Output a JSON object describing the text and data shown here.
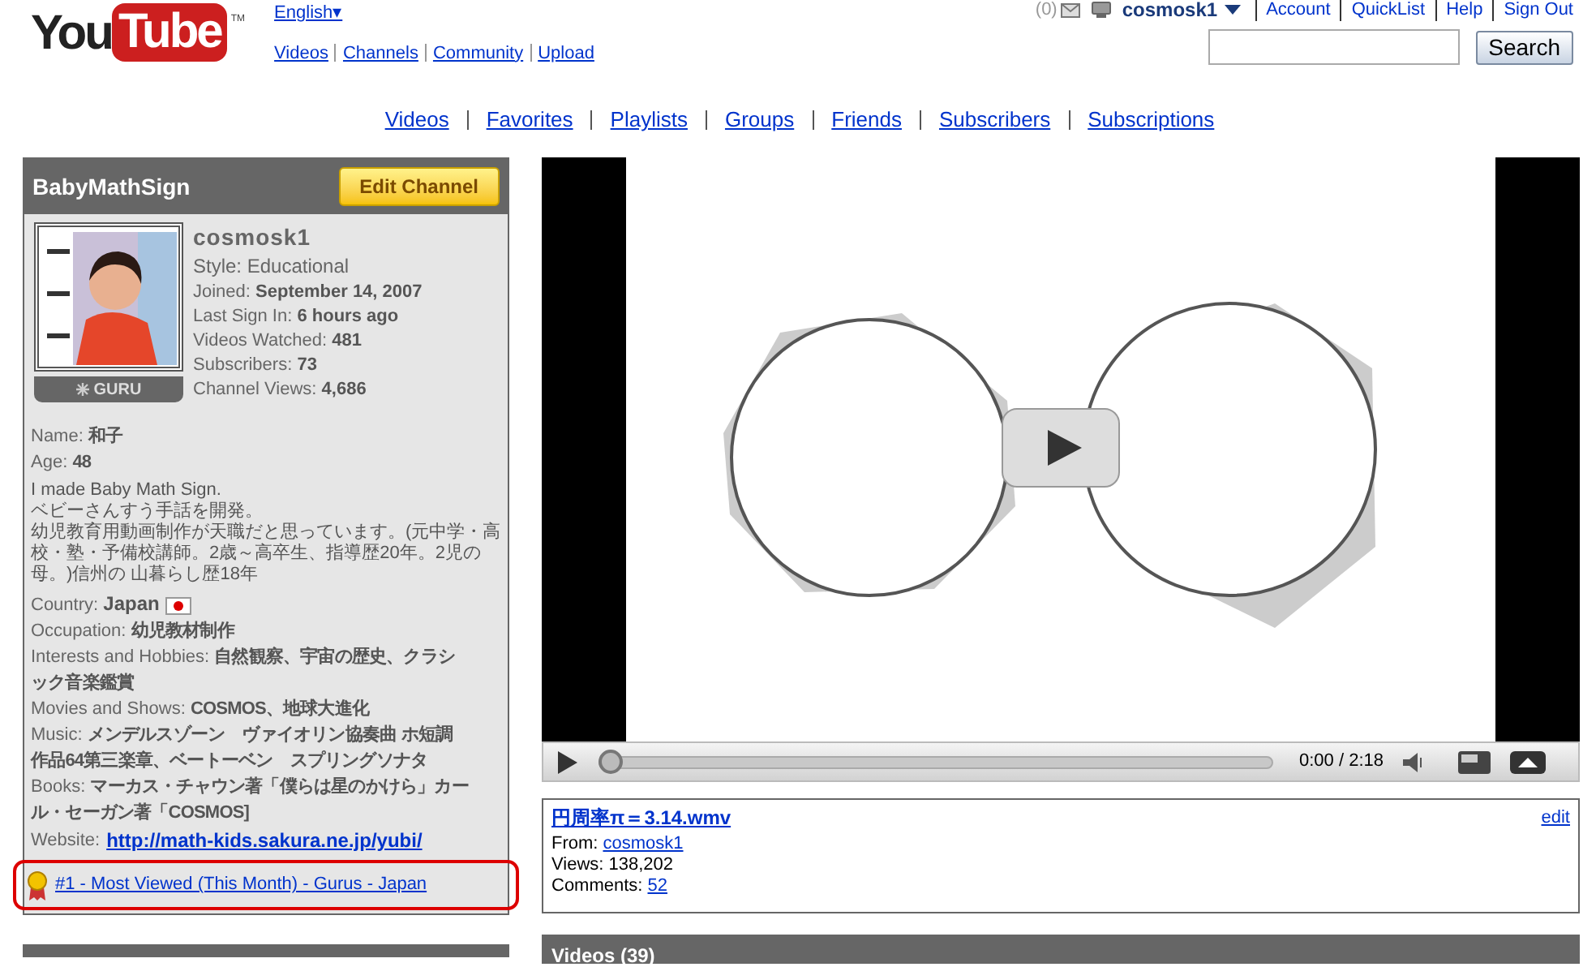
{
  "logo": {
    "left": "You",
    "right": "Tube",
    "mark": "TM"
  },
  "language": "English▾",
  "top_links": [
    "Videos",
    "Channels",
    "Community",
    "Upload"
  ],
  "user_bar": {
    "message_count": "(0)",
    "username": "cosmosk1",
    "links": [
      "Account",
      "QuickList",
      "Help",
      "Sign Out"
    ]
  },
  "search": {
    "button": "Search"
  },
  "nav": [
    "Videos",
    "Favorites",
    "Playlists",
    "Groups",
    "Friends",
    "Subscribers",
    "Subscriptions"
  ],
  "channel": {
    "title": "BabyMathSign",
    "edit_button": "Edit Channel",
    "badge": "GURU",
    "username": "cosmosk1",
    "style": "Style: Educational",
    "stats": [
      {
        "label": "Joined:",
        "value": "September 14, 2007"
      },
      {
        "label": "Last Sign In:",
        "value": "6 hours ago"
      },
      {
        "label": "Videos Watched:",
        "value": "481"
      },
      {
        "label": "Subscribers:",
        "value": "73"
      },
      {
        "label": "Channel Views:",
        "value": "4,686"
      }
    ],
    "details": [
      {
        "kind": "field",
        "label": "Name:",
        "value": "和子"
      },
      {
        "kind": "field",
        "label": "Age:",
        "value": "48"
      },
      {
        "kind": "paragraph",
        "lines": [
          "I made Baby Math Sign.",
          "ベビーさんすう手話を開発。",
          "幼児教育用動画制作が天職だと思っています。(元中学・高校・塾・予備校講師。2歳～高卒生、指導歴20年。2児の母。)信州の 山暮らし歴18年"
        ]
      },
      {
        "kind": "country",
        "label": "Country:",
        "value": "Japan"
      },
      {
        "kind": "field",
        "label": "Occupation:",
        "value": "幼児教材制作"
      },
      {
        "kind": "field",
        "label": "Interests and Hobbies:",
        "value": "自然観察、宇宙の歴史、クラシ",
        "more": [
          "ック音楽鑑賞"
        ]
      },
      {
        "kind": "field",
        "label": "Movies and Shows:",
        "value": "COSMOS、地球大進化"
      },
      {
        "kind": "field",
        "label": "Music:",
        "value": "メンデルスゾーン　ヴァイオリン協奏曲 ホ短調",
        "more": [
          "作品64第三楽章、ベートーベン　スプリングソナタ"
        ]
      },
      {
        "kind": "field",
        "label": "Books:",
        "value": "マーカス・チャウン著「僕らは星のかけら」カー",
        "more": [
          "ル・セーガン著「COSMOS]"
        ]
      },
      {
        "kind": "link",
        "label": "Website:",
        "value": "http://math-kids.sakura.ne.jp/yubi/"
      }
    ],
    "award": "#1 - Most Viewed (This Month) - Gurus - Japan"
  },
  "player": {
    "time": "0:00 / 2:18",
    "level": 0
  },
  "video_info": {
    "title": "円周率π＝3.14.wmv",
    "edit": "edit",
    "from_label": "From:",
    "from": "cosmosk1",
    "views": "Views: 138,202",
    "comments_label": "Comments:",
    "comments": "52"
  },
  "videos_section": {
    "title": "Videos (39)"
  }
}
